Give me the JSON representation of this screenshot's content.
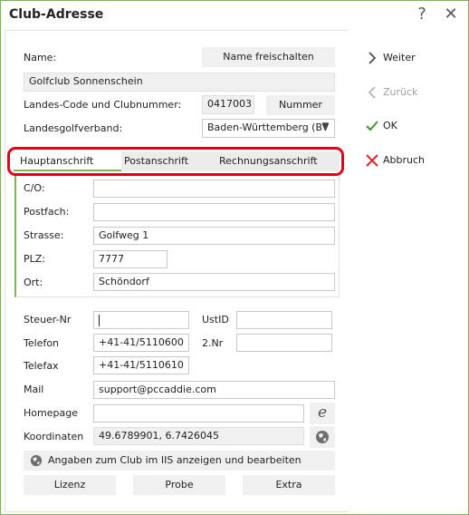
{
  "window": {
    "title": "Club-Adresse",
    "help_glyph": "?",
    "close_glyph": "✕"
  },
  "top": {
    "name_label": "Name:",
    "name_unlock_button": "Name freischalten",
    "name_value": "Golfclub Sonnenschein",
    "code_label": "Landes-Code und Clubnummer:",
    "code_value": "0417003",
    "number_button": "Nummer",
    "association_label": "Landesgolfverband:",
    "association_value": "Baden-Württemberg (BV"
  },
  "tabs": [
    {
      "label": "Hauptanschrift"
    },
    {
      "label": "Postanschrift"
    },
    {
      "label": "Rechnungsanschrift"
    }
  ],
  "address": {
    "co_label": "C/O:",
    "co_value": "",
    "postfach_label": "Postfach:",
    "postfach_value": "",
    "strasse_label": "Strasse:",
    "strasse_value": "Golfweg 1",
    "plz_label": "PLZ:",
    "plz_value": "7777",
    "ort_label": "Ort:",
    "ort_value": "Schöndorf"
  },
  "contact": {
    "steuer_label": "Steuer-Nr",
    "steuer_value": "",
    "ustid_label": "UstID",
    "ustid_value": "",
    "telefon_label": "Telefon",
    "telefon_value": "+41-41/5110600",
    "znr_label": "2.Nr",
    "znr_value": "",
    "telefax_label": "Telefax",
    "telefax_value": "+41-41/5110610",
    "mail_label": "Mail",
    "mail_value": "support@pccaddie.com",
    "homepage_label": "Homepage",
    "homepage_value": "",
    "koordinaten_label": "Koordinaten",
    "koordinaten_value": "49.6789901, 6.7426045"
  },
  "iis_button": "Angaben zum Club im IIS anzeigen und bearbeiten",
  "bottom_buttons": {
    "lizenz": "Lizenz",
    "probe": "Probe",
    "extra": "Extra"
  },
  "side": {
    "weiter": "Weiter",
    "zurueck": "Zurück",
    "ok": "OK",
    "abbruch": "Abbruch"
  },
  "colors": {
    "accent": "#7fb05c",
    "highlight": "#e3001b",
    "ok_green": "#3a9a2a",
    "cancel_red": "#d8262c"
  }
}
